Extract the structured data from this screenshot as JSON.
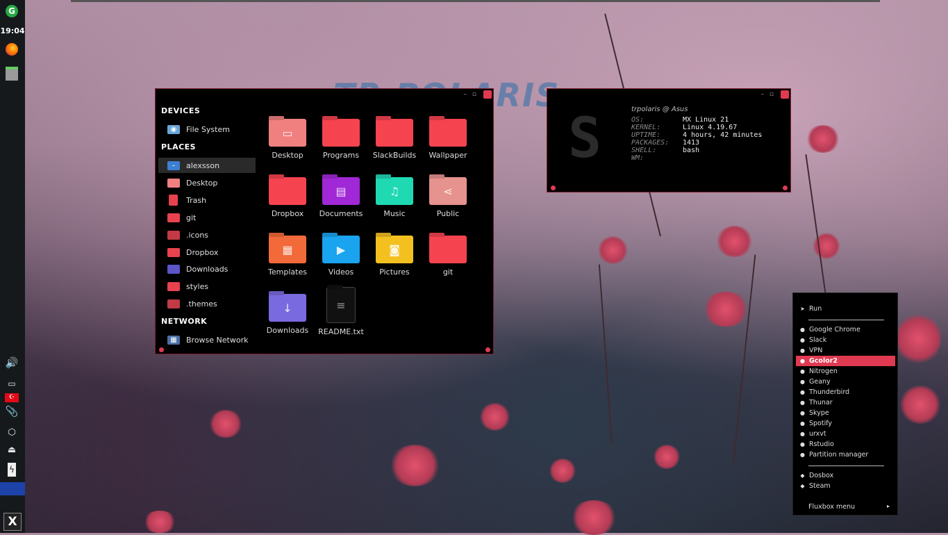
{
  "panel": {
    "clock": "19:04",
    "icons": [
      "update-icon",
      "firefox-icon",
      "file-manager-icon",
      "volume-icon",
      "network-icon",
      "turkey-flag-icon",
      "clipboard-icon",
      "package-icon",
      "eject-icon",
      "battery-icon"
    ],
    "mx_logo": "X"
  },
  "watermark": "TR POLARIS",
  "file_manager": {
    "sidebar": {
      "devices_heading": "DEVICES",
      "devices": [
        {
          "label": "File System",
          "icon": "drive-icon"
        }
      ],
      "places_heading": "PLACES",
      "places": [
        {
          "label": "alexsson",
          "icon": "home-folder-icon"
        },
        {
          "label": "Desktop",
          "icon": "desktop-folder-icon"
        },
        {
          "label": "Trash",
          "icon": "trash-icon"
        },
        {
          "label": "git",
          "icon": "folder-icon"
        },
        {
          "label": ".icons",
          "icon": "folder-icon"
        },
        {
          "label": "Dropbox",
          "icon": "folder-icon"
        },
        {
          "label": "Downloads",
          "icon": "downloads-folder-icon"
        },
        {
          "label": "styles",
          "icon": "folder-icon"
        },
        {
          "label": ".themes",
          "icon": "folder-icon"
        }
      ],
      "network_heading": "NETWORK",
      "network": [
        {
          "label": "Browse Network",
          "icon": "network-icon"
        }
      ]
    },
    "items": [
      {
        "label": "Desktop",
        "color": "#f08080",
        "icon": "▭"
      },
      {
        "label": "Programs",
        "color": "#f5434f",
        "icon": ""
      },
      {
        "label": "SlackBuilds",
        "color": "#f5434f",
        "icon": ""
      },
      {
        "label": "Wallpaper",
        "color": "#f5434f",
        "icon": ""
      },
      {
        "label": "Dropbox",
        "color": "#f5434f",
        "icon": ""
      },
      {
        "label": "Documents",
        "color": "#a128d6",
        "icon": "▤"
      },
      {
        "label": "Music",
        "color": "#1fd9b3",
        "icon": "♫"
      },
      {
        "label": "Public",
        "color": "#e6928e",
        "icon": "⋖"
      },
      {
        "label": "Templates",
        "color": "#f26a3a",
        "icon": "▦"
      },
      {
        "label": "Videos",
        "color": "#1aa3ee",
        "icon": "▶"
      },
      {
        "label": "Pictures",
        "color": "#f4c020",
        "icon": "◙"
      },
      {
        "label": "git",
        "color": "#f5434f",
        "icon": ""
      },
      {
        "label": "Downloads",
        "color": "#7a6ae0",
        "icon": "↓"
      },
      {
        "label": "README.txt",
        "color": "#111111",
        "icon": "≡"
      }
    ]
  },
  "terminal": {
    "header_user": "trpolaris",
    "header_host": "Asus",
    "rows": [
      {
        "key": "OS:",
        "value": "MX Linux 21"
      },
      {
        "key": "KERNEL:",
        "value": "Linux 4.19.67"
      },
      {
        "key": "UPTIME:",
        "value": "4 hours, 42 minutes"
      },
      {
        "key": "PACKAGES:",
        "value": "1413"
      },
      {
        "key": "SHELL:",
        "value": "bash"
      },
      {
        "key": "WM:",
        "value": ""
      }
    ]
  },
  "menu": {
    "run": "Run",
    "apps": [
      "Google Chrome",
      "Slack",
      "VPN",
      "Gcolor2",
      "Nitrogen",
      "Geany",
      "Thunderbird",
      "Thunar",
      "Skype",
      "Spotify",
      "urxvt",
      "Rstudio",
      "Partition manager"
    ],
    "selected": "Gcolor2",
    "games": [
      "Dosbox",
      "Steam"
    ],
    "title": "Fluxbox menu"
  }
}
